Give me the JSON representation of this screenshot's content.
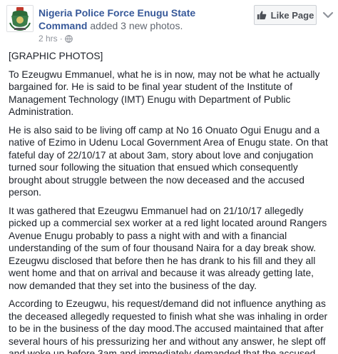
{
  "post": {
    "page_name_line1": "Nigeria Police Force Enugu State",
    "page_name_line2": "Command",
    "action": " added 3 new photos.",
    "time": "2 hrs",
    "separator": "·",
    "like_button_label": "Like Page",
    "paragraphs": [
      "[GRAPHIC PHOTOS]",
      "To Ezeugwu Emmanuel, what he is in now, may not be what he actually bargained for. He is said to be final year student of the Institute of Management Technology (IMT) Enugu with Department of Public Administration.",
      "He is also said to be living off camp at No 16 Onuato Ogui Enugu and a native of Ezimo in Udenu Local Government Area of Enugu state. On that fateful day of 22/10/17 at about 3am, story about love and conjugation turned sour following the situation that ensued which consequently brought about struggle between the now deceased and the accused person.",
      "It was gathered that Ezeugwu Emmanuel had on 21/10/17 allegedly picked up a commercial sex worker at a red light located around Rangers Avenue Enugu probably to pass a night with and with a financial understanding of the sum of four thousand Naira for a day break show. Ezeugwu disclosed that before then he has drank to his fill and they all went home and that on arrival and because it was already getting late, now demanded that they set into the business of the day.",
      "According to Ezeugwu, his request/demand did not influence anything as the deceased allegedly requested to finish what she was inhaling in order to be in the business of the day mood.The accused maintained that after several hours of his pressurizing her and without any answer, he slept off and woke up before 3am and immediately demanded that the accused"
    ]
  },
  "colors": {
    "link": "#365899",
    "text": "#1d2129",
    "meta": "#90949c",
    "button_bg": "#f5f6f7"
  },
  "icons": {
    "avatar": "police-crest-avatar",
    "globe": "globe-icon",
    "like": "thumbs-up-icon",
    "menu": "chevron-down-icon"
  }
}
